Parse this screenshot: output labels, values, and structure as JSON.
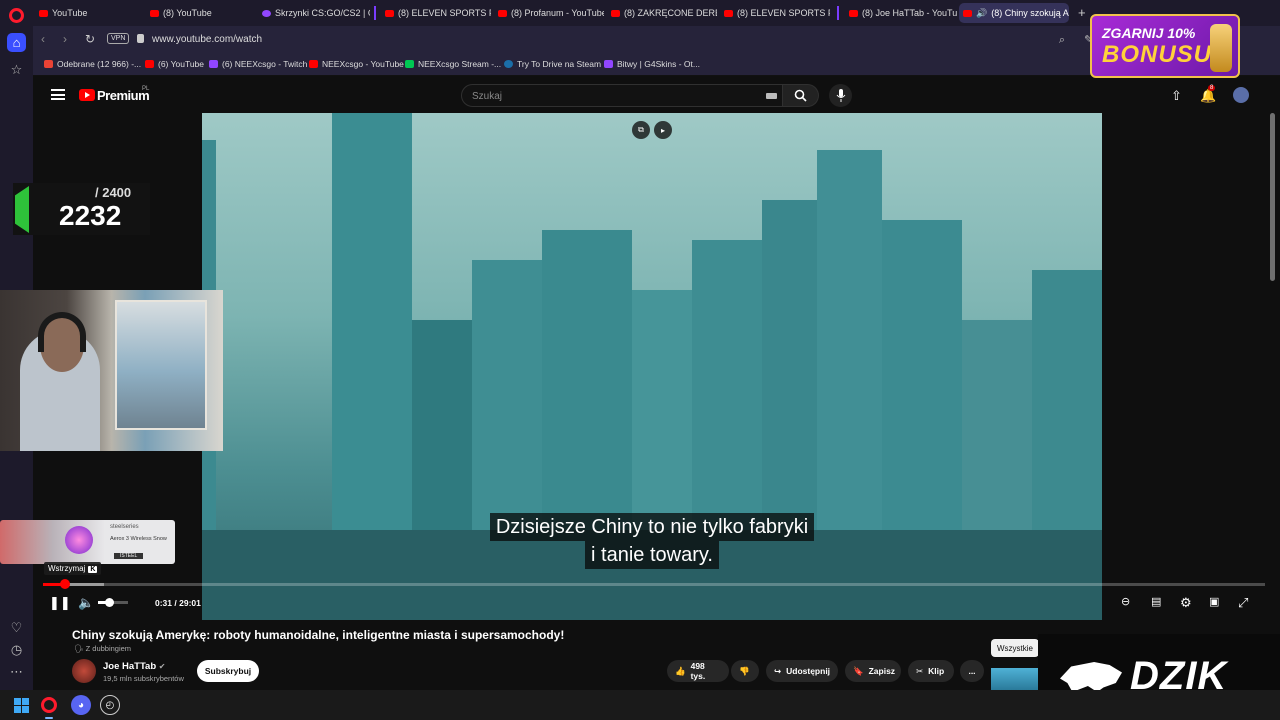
{
  "browser": {
    "tabs": [
      {
        "label": "YouTube",
        "type": "youtube"
      },
      {
        "label": "(8) YouTube",
        "type": "youtube"
      },
      {
        "label": "Skrzynki CS:GO/CS2 | G4S",
        "type": "purple"
      },
      {
        "label": "(8) ELEVEN SPORTS PL - Y",
        "type": "youtube"
      },
      {
        "label": "(8) Profanum - YouTube",
        "type": "youtube"
      },
      {
        "label": "(8) ZAKRĘCONE DERBY W",
        "type": "youtube"
      },
      {
        "label": "(8) ELEVEN SPORTS PL - Y",
        "type": "youtube"
      },
      {
        "label": "(8) Joe HaTTab - YouTube",
        "type": "youtube"
      },
      {
        "label": "(8) Chiny szokują Ame",
        "type": "youtube",
        "active": true
      }
    ],
    "new_tab": "+",
    "vpn": "VPN",
    "url": "www.youtube.com/watch",
    "bookmarks": [
      {
        "label": "Odebrane (12 966) -...",
        "icon": "gmail"
      },
      {
        "label": "(6) YouTube",
        "icon": "youtube"
      },
      {
        "label": "(6) NEEXcsgo - Twitch",
        "icon": "twitch"
      },
      {
        "label": "NEEXcsgo - YouTube",
        "icon": "youtube"
      },
      {
        "label": "NEEXcsgo Stream -...",
        "icon": "neex"
      },
      {
        "label": "Try To Drive na Steam",
        "icon": "steam"
      },
      {
        "label": "Bitwy | G4Skins - Ot...",
        "icon": "twitch"
      }
    ]
  },
  "ad_bonus": {
    "line1": "ZGARNIJ 10%",
    "line2": "BONUSU"
  },
  "youtube": {
    "brand": "Premium",
    "region": "PL",
    "search_placeholder": "Szukaj",
    "notification_count": "8",
    "subtitle_lines": [
      "Dzisiejsze Chiny to nie tylko fabryki",
      "i tanie towary."
    ],
    "player": {
      "current_time": "0:31",
      "duration": "29:01",
      "progress_fraction": 0.018,
      "buffered_fraction": 0.05,
      "volume_fraction": 0.35,
      "pause_tooltip": "Wstrzymaj",
      "pause_shortcut": "K"
    },
    "video_title": "Chiny szokują Amerykę: roboty humanoidalne, inteligentne miasta i supersamochody!",
    "dub_label": "Z dubbingiem",
    "channel": {
      "name": "Joe HaTTab",
      "subscribers": "19,5 mln subskrybentów",
      "verified": true
    },
    "subscribe_label": "Subskrybuj",
    "actions": {
      "likes": "498 tys.",
      "share": "Udostępnij",
      "save": "Zapisz",
      "clip": "Klip",
      "more": "..."
    },
    "all_label": "Wszystkie"
  },
  "overlay": {
    "score_max": "/ 2400",
    "score_current": "2232",
    "steelseries": {
      "brand": "steelseries",
      "product": "Aerox 3 Wireless Snow",
      "tag": "ISTEEL"
    }
  },
  "sponsor": {
    "name": "DZIK"
  },
  "colors": {
    "youtube_red": "#ff0000",
    "opera_accent": "#3a4fff",
    "bonus_purple": "#a82bd6",
    "bonus_gold": "#ffd23a"
  }
}
